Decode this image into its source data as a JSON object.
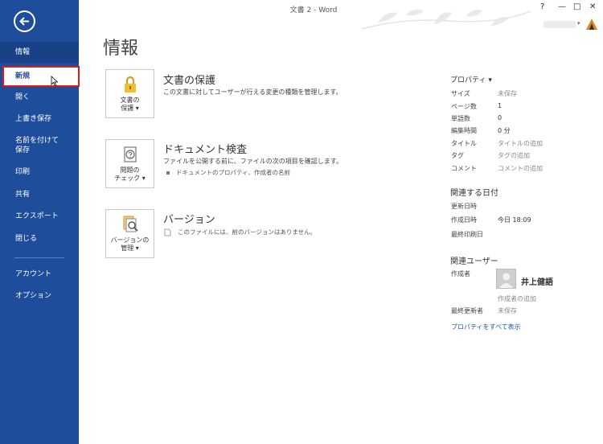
{
  "window": {
    "title": "文書 2 - Word",
    "controls": [
      "?",
      "—",
      "□",
      "✕"
    ]
  },
  "sidebar": {
    "items": [
      {
        "label": "情報"
      },
      {
        "label": "新規"
      },
      {
        "label": "開く"
      },
      {
        "label": "上書き保存"
      },
      {
        "label": "名前を付けて\n保存"
      },
      {
        "label": "印刷"
      },
      {
        "label": "共有"
      },
      {
        "label": "エクスポート"
      },
      {
        "label": "閉じる"
      },
      {
        "label": "アカウント"
      },
      {
        "label": "オプション"
      }
    ]
  },
  "main": {
    "title": "情報",
    "sections": [
      {
        "button": "文書の\n保護 ▾",
        "heading": "文書の保護",
        "desc": "この文書に対してユーザーが行える変更の種類を管理します。",
        "bullet": ""
      },
      {
        "button": "問題の\nチェック ▾",
        "heading": "ドキュメント検査",
        "desc": "ファイルを公開する前に、ファイルの次の項目を確認します。",
        "bullet": "ドキュメントのプロパティ、作成者の名前"
      },
      {
        "button": "バージョンの\n管理 ▾",
        "heading": "バージョン",
        "desc": "",
        "bullet": "このファイルには、前のバージョンはありません。"
      }
    ]
  },
  "properties": {
    "heading": "プロパティ ▾",
    "rows": [
      {
        "label": "サイズ",
        "value": "未保存"
      },
      {
        "label": "ページ数",
        "value": "1"
      },
      {
        "label": "単語数",
        "value": "0"
      },
      {
        "label": "編集時間",
        "value": "0 分"
      },
      {
        "label": "タイトル",
        "value": "タイトルの追加"
      },
      {
        "label": "タグ",
        "value": "タグの追加"
      },
      {
        "label": "コメント",
        "value": "コメントの追加"
      }
    ],
    "dates_heading": "関連する日付",
    "dates": [
      {
        "label": "更新日時",
        "value": ""
      },
      {
        "label": "作成日時",
        "value": "今日 18:09"
      },
      {
        "label": "最終印刷日",
        "value": ""
      }
    ],
    "people_heading": "関連ユーザー",
    "author_label": "作成者",
    "author_name": "井上健語",
    "add_author": "作成者の追加",
    "last_modified_label": "最終更新者",
    "last_modified_value": "未保存",
    "show_all": "プロパティをすべて表示"
  }
}
